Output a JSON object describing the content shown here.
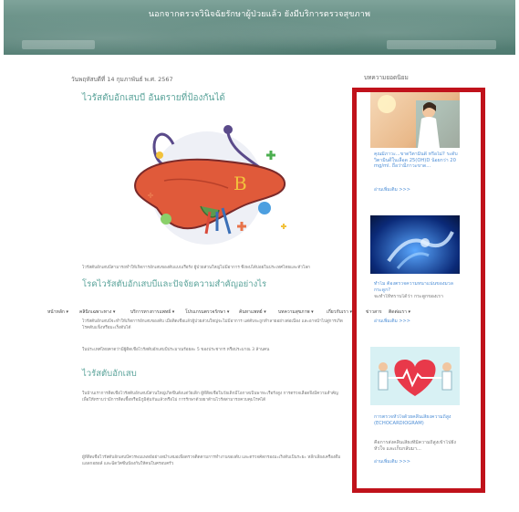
{
  "header": {
    "banner_text": "นอกจากตรวจวินิจฉัยรักษาผู้ป่วยแล้ว ยังมีบริการตรวจสุขภาพ"
  },
  "article": {
    "date": "วันพฤหัสบดีที่ 14 กุมภาพันธ์ พ.ศ. 2567",
    "title": "ไวรัสตับอักเสบบี อันตรายที่ป้องกันได้",
    "image_letter": "B",
    "intro": "ไวรัสตับอักเสบบีสามารถทำให้เกิดการอักเสบของตับแบบเรื้อรัง ผู้ป่วยส่วนใหญ่ไม่มีอาการ ซึ่งพบได้บ่อยในประเทศไทยและทั่วโลก",
    "section2_title": "โรคไวรัสตับอักเสบบีและปัจจัยความสำคัญอย่างไร",
    "section2_p1": "ไวรัสตับอักเสบบีจะทำให้เกิดการอักเสบของตับ เมื่อติดเชื้อแล้วผู้ป่วยส่วนใหญ่จะไม่มีอาการ แต่ตับจะถูกทำลายอย่างต่อเนื่อง และอาจนำไปสู่การเกิดโรคตับแข็งหรือมะเร็งตับได้",
    "section2_p2": "ในประเทศไทยคาดว่ามีผู้ติดเชื้อไวรัสตับอักเสบบีประมาณร้อยละ 5 ของประชากร หรือประมาณ 3 ล้านคน",
    "section3_title": "ไวรัสตับอักเสบ",
    "section3_p1": "ในบ้านเราการติดเชื้อไวรัสตับอักเสบบีส่วนใหญ่เกิดขึ้นตั้งแต่วัยเด็ก ผู้ที่ติดเชื้อในวัยเด็กมีโอกาสเป็นพาหะเรื้อรังสูง การตรวจเลือดจึงมีความสำคัญ เพื่อให้ทราบว่ามีการติดเชื้อหรือมีภูมิคุ้มกันแล้วหรือไม่ การรักษาด้วยยาต้านไวรัสสามารถควบคุมโรคได้",
    "section3_p2": "ผู้ที่ติดเชื้อไวรัสตับอักเสบบีควรพบแพทย์อย่างสม่ำเสมอเพื่อตรวจติดตามการทำงานของตับ และตรวจคัดกรองมะเร็งตับเป็นระยะ หลีกเลี่ยงเครื่องดื่มแอลกอฮอล์ และฉีดวัคซีนป้องกันให้คนในครอบครัว"
  },
  "nav": {
    "items": [
      "หน้าหลัก ▾",
      "คลินิกเฉพาะทาง ▾",
      "บริการทางการแพทย์ ▾",
      "โปรแกรมตรวจรักษา ▾",
      "ค้นหาแพทย์ ▾",
      "บทความสุขภาพ ▾",
      "เกี่ยวกับเรา ▾",
      "ข่าวสาร",
      "ติดต่อเรา ▾"
    ]
  },
  "sidebar": {
    "heading": "บทความยอดนิยม",
    "cards": [
      {
        "title": "คุณมีภาวะ...ขาดวิตามินดี หรือไม่? ระดับวิตามินดีในเลือด 25(OH)D น้อยกว่า 20 mg/ml. ถือว่ามีภาวะขาด...",
        "desc": "",
        "more": "อ่านเพิ่มเติม >>>"
      },
      {
        "title": "ทำไม ต้องตรวจความหนาแน่นของมวลกระดูก?",
        "desc": "จะทำให้ทราบได้ว่า กระดูกของเรา",
        "more": "อ่านเพิ่มเติม >>>"
      },
      {
        "title": "การตรวจหัวใจด้วยคลื่นเสียงความถี่สูง (ECHOCARDIOGRAM)",
        "desc": "คือการส่งคลื่นเสียงที่มีความถี่สูงเข้าไปยังหัวใจ และเก็บกลับมา...",
        "more": "อ่านเพิ่มเติม >>>"
      }
    ]
  },
  "colors": {
    "accent": "#5aa39a",
    "link": "#4f8fd6",
    "highlight_border": "#c0121b",
    "liver": "#e05a3a"
  }
}
